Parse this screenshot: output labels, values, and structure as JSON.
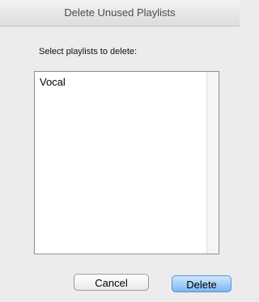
{
  "window": {
    "title": "Delete Unused Playlists"
  },
  "dialog": {
    "prompt": "Select playlists to delete:"
  },
  "playlists": [
    {
      "label": "Vocal"
    }
  ],
  "buttons": {
    "cancel_label": "Cancel",
    "delete_label": "Delete"
  },
  "colors": {
    "default_button": "#7db7f0",
    "background": "#ececec"
  }
}
